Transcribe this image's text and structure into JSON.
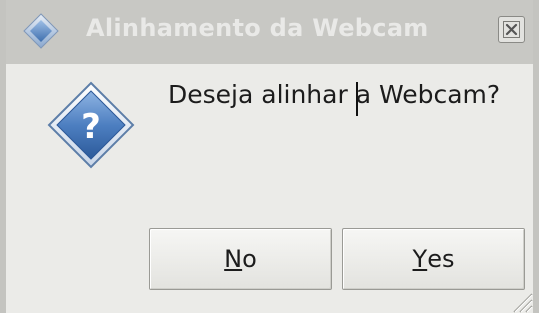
{
  "window": {
    "title": "Alinhamento da Webcam"
  },
  "dialog": {
    "message": "Deseja alinhar a Webcam?",
    "icon": "question-icon"
  },
  "buttons": {
    "no": {
      "mnemonic": "N",
      "rest": "o"
    },
    "yes": {
      "mnemonic": "Y",
      "rest": "es"
    }
  },
  "colors": {
    "titlebar": "#c8c8c4",
    "title_text": "#e9e9e7",
    "dialog_bg": "#ebebe8",
    "icon_blue": "#3d73b8"
  }
}
